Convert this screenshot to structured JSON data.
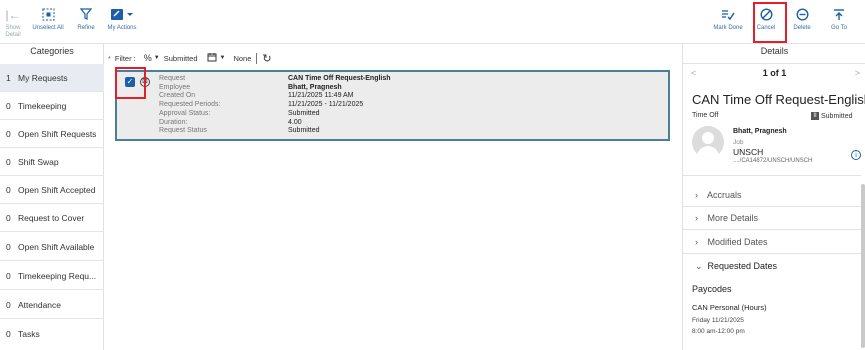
{
  "toolbar": {
    "show_detail": "Show\nDetail",
    "unselect_all": "Unselect All",
    "refine": "Refine",
    "my_actions": "My Actions",
    "mark_done": "Mark Done",
    "cancel": "Cancel",
    "delete": "Delete",
    "go_to": "Go To"
  },
  "categories": {
    "title": "Categories",
    "items": [
      {
        "count": "1",
        "label": "My Requests"
      },
      {
        "count": "0",
        "label": "Timekeeping"
      },
      {
        "count": "0",
        "label": "Open Shift Requests"
      },
      {
        "count": "0",
        "label": "Shift Swap"
      },
      {
        "count": "0",
        "label": "Open Shift Accepted"
      },
      {
        "count": "0",
        "label": "Request to Cover"
      },
      {
        "count": "0",
        "label": "Open Shift Available"
      },
      {
        "count": "0",
        "label": "Timekeeping Requ..."
      },
      {
        "count": "0",
        "label": "Attendance"
      },
      {
        "count": "0",
        "label": "Tasks"
      }
    ]
  },
  "filter": {
    "required_mark": "*",
    "label": "Filter :",
    "status_value": "Submitted",
    "date_value": "None"
  },
  "request": {
    "rows": [
      {
        "key": "Request",
        "value": "CAN Time Off Request-English"
      },
      {
        "key": "Employee",
        "value": "Bhatt, Pragnesh"
      },
      {
        "key": "Created On",
        "value": "11/21/2025 11:49 AM"
      },
      {
        "key": "Requested Periods:",
        "value": "11/21/2025 - 11/21/2025"
      },
      {
        "key": "Approval Status:",
        "value": "Submitted"
      },
      {
        "key": "Duration:",
        "value": "4.00"
      },
      {
        "key": "Request Status",
        "value": "Submitted"
      }
    ]
  },
  "details": {
    "title": "Details",
    "pager": "1 of 1",
    "heading": "CAN Time Off Request-English",
    "type": "Time Off",
    "status": "Submitted",
    "employee_name": "Bhatt, Pragnesh",
    "job_label": "Job",
    "org": "UNSCH",
    "org_path": "..../CA14872/UNSCH/UNSCH",
    "sections": [
      "Accruals",
      "More Details",
      "Modified Dates",
      "Requested Dates"
    ],
    "paycodes_title": "Paycodes",
    "paycode_name": "CAN Personal (Hours)",
    "paycode_date": "Friday 11/21/2025",
    "paycode_time": "8:00 am-12:00 pm"
  },
  "colors": {
    "accent": "#1a5fa8",
    "highlight": "#e0202a",
    "card_border": "#4a7f96"
  }
}
